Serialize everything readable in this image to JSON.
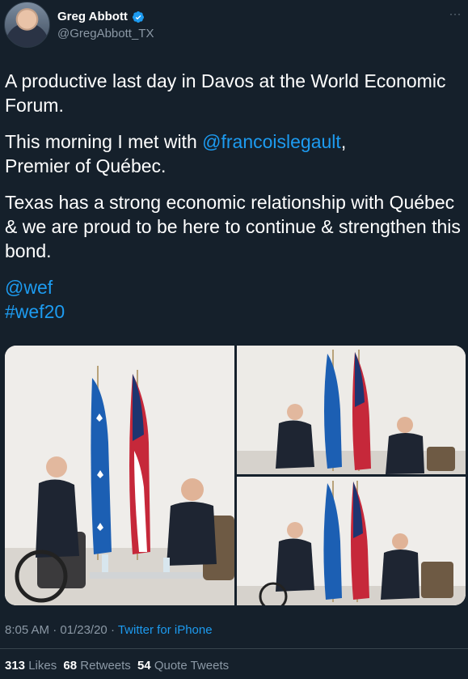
{
  "user": {
    "display_name": "Greg Abbott",
    "handle": "@GregAbbott_TX"
  },
  "menu": {
    "more_label": "···"
  },
  "tweet": {
    "line1": "A productive last day in Davos at the World Economic Forum.",
    "line2_prefix": "This morning I met with ",
    "line2_mention": "@francoislegault",
    "line2_suffix": ",",
    "line2_rest": "Premier of Québec.",
    "line3": "Texas has a strong economic relationship with Québec & we are proud to be here to continue & strengthen this bond.",
    "mention_wef": "@wef",
    "hashtag": "#wef20"
  },
  "meta": {
    "time": "8:05 AM",
    "separator1": " · ",
    "date": "01/23/20",
    "separator2": " · ",
    "source": "Twitter for iPhone"
  },
  "stats": {
    "likes_count": "313",
    "likes_label": "Likes",
    "retweets_count": "68",
    "retweets_label": "Retweets",
    "quote_count": "54",
    "quote_label": "Quote Tweets"
  },
  "colors": {
    "background": "#15202b",
    "link": "#1d9bf0",
    "secondary_text": "#8b98a5",
    "verified": "#1d9bf0"
  }
}
